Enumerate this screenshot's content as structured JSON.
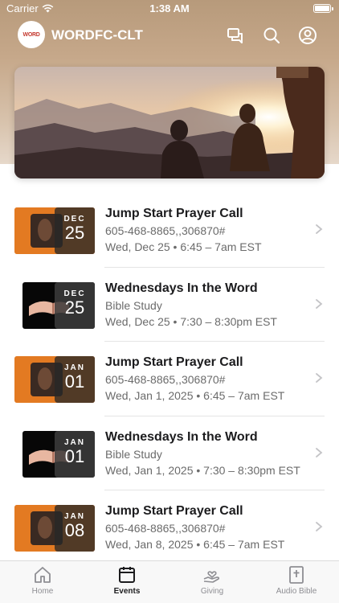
{
  "status_bar": {
    "carrier": "Carrier",
    "time": "1:38 AM"
  },
  "header": {
    "logo_text": "WORD",
    "title": "WORDFC-CLT",
    "icons": [
      "chat-icon",
      "search-icon",
      "profile-icon"
    ]
  },
  "events": [
    {
      "title": "Jump Start Prayer Call",
      "subtitle": "605-468-8865,,306870#",
      "datetime": "Wed, Dec 25 • 6:45 – 7am EST",
      "month": "DEC",
      "day": "25",
      "thumb": "prayer"
    },
    {
      "title": "Wednesdays In the Word",
      "subtitle": "Bible Study",
      "datetime": "Wed, Dec 25 • 7:30 – 8:30pm EST",
      "month": "DEC",
      "day": "25",
      "thumb": "bible"
    },
    {
      "title": "Jump Start Prayer Call",
      "subtitle": "605-468-8865,,306870#",
      "datetime": "Wed, Jan 1, 2025 • 6:45 – 7am EST",
      "month": "JAN",
      "day": "01",
      "thumb": "prayer"
    },
    {
      "title": "Wednesdays In the Word",
      "subtitle": "Bible Study",
      "datetime": "Wed, Jan 1, 2025 • 7:30 – 8:30pm EST",
      "month": "JAN",
      "day": "01",
      "thumb": "bible"
    },
    {
      "title": "Jump Start Prayer Call",
      "subtitle": "605-468-8865,,306870#",
      "datetime": "Wed, Jan 8, 2025 • 6:45 – 7am EST",
      "month": "JAN",
      "day": "08",
      "thumb": "prayer"
    }
  ],
  "tabs": [
    {
      "label": "Home",
      "icon": "home-icon",
      "active": false
    },
    {
      "label": "Events",
      "icon": "calendar-icon",
      "active": true
    },
    {
      "label": "Giving",
      "icon": "giving-icon",
      "active": false
    },
    {
      "label": "Audio Bible",
      "icon": "bible-icon",
      "active": false
    }
  ],
  "colors": {
    "accent": "#1c1c1e",
    "header_bg": "#c6a88a",
    "inactive_tab": "#8e8e93"
  }
}
